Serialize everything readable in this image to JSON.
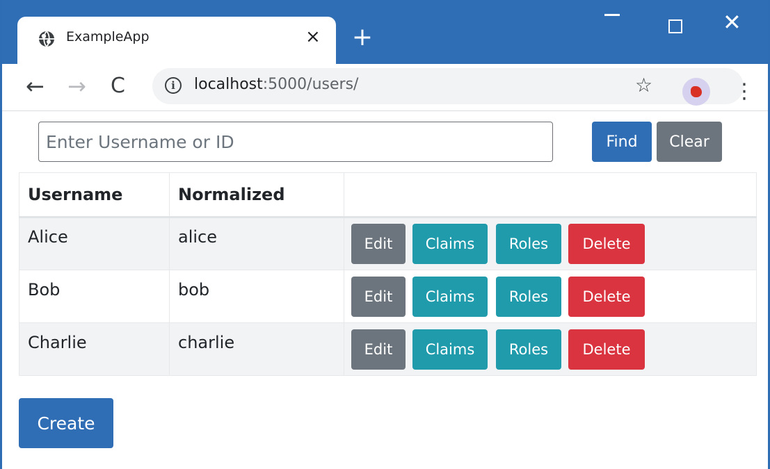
{
  "browser": {
    "tab_title": "ExampleApp",
    "tab_close": "×",
    "new_tab": "+",
    "url_host": "localhost",
    "url_rest": ":5000/users/",
    "info_icon": "i",
    "star_icon": "☆",
    "menu_icon": "⋮",
    "back_icon": "←",
    "forward_icon": "→",
    "reload_icon": "C",
    "close_icon": "✕"
  },
  "search": {
    "placeholder": "Enter Username or ID",
    "find_label": "Find",
    "clear_label": "Clear"
  },
  "table": {
    "headers": [
      "Username",
      "Normalized",
      ""
    ],
    "rows": [
      {
        "username": "Alice",
        "normalized": "alice"
      },
      {
        "username": "Bob",
        "normalized": "bob"
      },
      {
        "username": "Charlie",
        "normalized": "charlie"
      }
    ],
    "actions": {
      "edit": "Edit",
      "claims": "Claims",
      "roles": "Roles",
      "delete": "Delete"
    }
  },
  "create_label": "Create",
  "colors": {
    "primary": "#2f6db5",
    "secondary": "#6c757d",
    "info": "#1f9bab",
    "danger": "#d9343f"
  }
}
